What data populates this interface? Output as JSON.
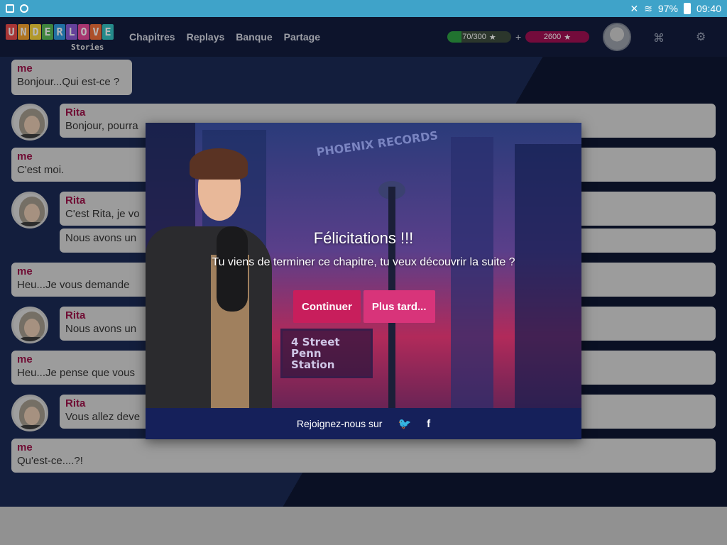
{
  "status_bar": {
    "battery": "97%",
    "time": "09:40"
  },
  "header": {
    "logo_letters": [
      "U",
      "N",
      "D",
      "E",
      "R",
      "L",
      "O",
      "V",
      "E"
    ],
    "logo_colors": [
      "#e84c4c",
      "#f2a12e",
      "#f6d33b",
      "#58b957",
      "#2e9ae0",
      "#8c5bd6",
      "#e84c9b",
      "#f06f3a",
      "#34c1c1"
    ],
    "logo_sub": "Stories",
    "nav": [
      "Chapitres",
      "Replays",
      "Banque",
      "Partage"
    ],
    "xp_text": "70/300",
    "xp_fraction": 0.233,
    "plus": "+",
    "gems_text": "2600"
  },
  "chat": {
    "messages": [
      {
        "who": "me",
        "text": "Bonjour...Qui est-ce ?"
      },
      {
        "who": "Rita",
        "text": "Bonjour, pourra"
      },
      {
        "who": "me",
        "text": "C'est moi."
      },
      {
        "who": "Rita",
        "text": "C'est Rita, je vo"
      },
      {
        "who": "",
        "text": "Nous avons un"
      },
      {
        "who": "me",
        "text": "Heu...Je vous demande"
      },
      {
        "who": "Rita",
        "text": "Nous avons un"
      },
      {
        "who": "me",
        "text": "Heu...Je pense que vous"
      },
      {
        "who": "Rita",
        "text": "Vous allez deve"
      },
      {
        "who": "me",
        "text": "Qu'est-ce....?!"
      }
    ]
  },
  "modal": {
    "title": "Félicitations !!!",
    "text": "Tu viens de terminer ce chapitre, tu veux découvrir la suite ?",
    "continue_label": "Continuer",
    "later_label": "Plus tard...",
    "footer_label": "Rejoignez-nous sur",
    "twitter_glyph": "🐦",
    "facebook_glyph": "f",
    "scene_sign": "PHOENIX RECORDS",
    "scene_station_1": "4 Street",
    "scene_station_2": "Penn Station"
  }
}
